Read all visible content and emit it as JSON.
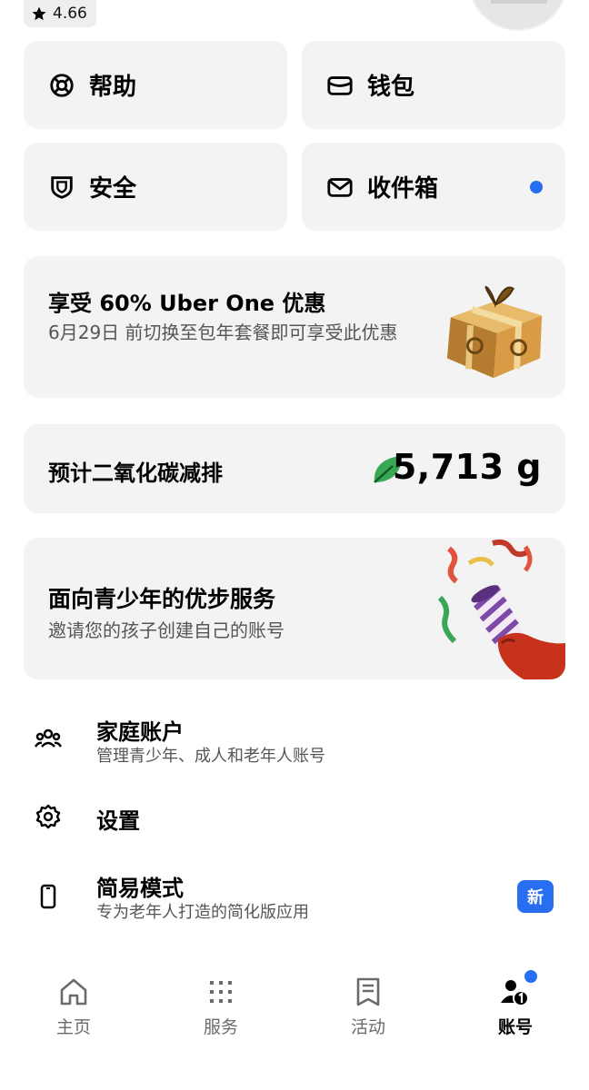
{
  "header": {
    "rating": "4.66",
    "rating_icon": "star-icon"
  },
  "tiles": [
    {
      "label": "帮助",
      "icon": "help-icon"
    },
    {
      "label": "钱包",
      "icon": "wallet-icon"
    },
    {
      "label": "安全",
      "icon": "shield-icon"
    },
    {
      "label": "收件箱",
      "icon": "inbox-icon",
      "has_unread": true
    }
  ],
  "promo": {
    "title": "享受 60% Uber One 优惠",
    "subtitle": "6月29日 前切换至包年套餐即可享受此优惠",
    "image": "gift-box"
  },
  "carbon": {
    "label": "预计二氧化碳减排",
    "value": "5,713 g",
    "icon": "leaf-icon"
  },
  "teen": {
    "title": "面向青少年的优步服务",
    "subtitle": "邀请您的孩子创建自己的账号",
    "image": "party-popper"
  },
  "list": [
    {
      "title": "家庭账户",
      "subtitle": "管理青少年、成人和老年人账号",
      "icon": "family-icon"
    },
    {
      "title": "设置",
      "icon": "settings-icon"
    },
    {
      "title": "简易模式",
      "subtitle": "专为老年人打造的简化版应用",
      "icon": "phone-icon",
      "badge": "新"
    }
  ],
  "nav": [
    {
      "label": "主页",
      "icon": "home-icon"
    },
    {
      "label": "服务",
      "icon": "grid-icon"
    },
    {
      "label": "活动",
      "icon": "receipt-icon"
    },
    {
      "label": "账号",
      "icon": "account-icon",
      "active": true
    }
  ],
  "colors": {
    "accent": "#276ef1",
    "card_bg": "#f3f3f3",
    "leaf": "#3aa757"
  }
}
